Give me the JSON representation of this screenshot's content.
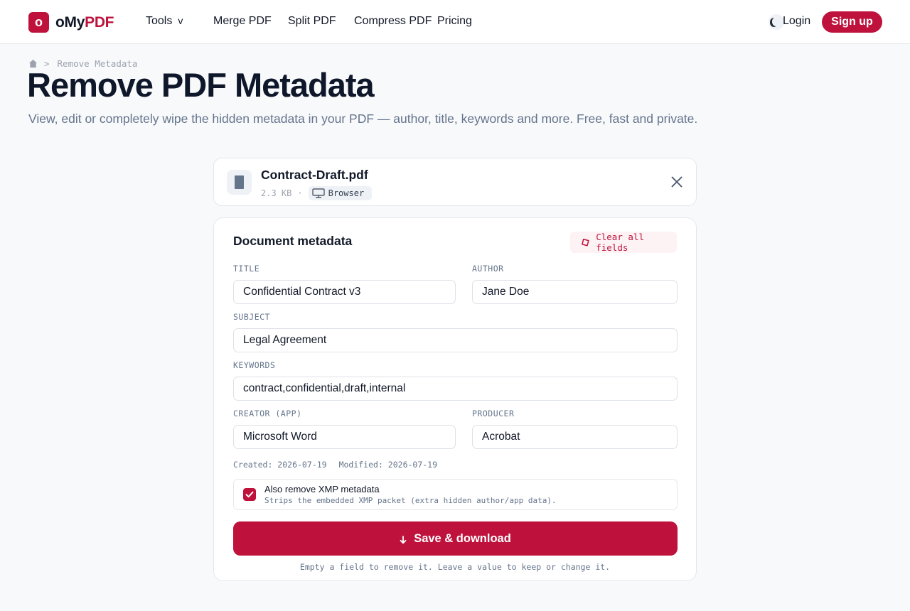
{
  "brand": {
    "mark": "o",
    "name_part1": "oMy",
    "name_part2": "PDF",
    "accent": "#be123c"
  },
  "nav": {
    "tools": "Tools",
    "tools_chevron": "v",
    "merge": "Merge PDF",
    "split": "Split PDF",
    "compress": "Compress PDF",
    "pricing": "Pricing",
    "theme_icon": "moon-icon",
    "login": "Login",
    "signup": "Sign up"
  },
  "breadcrumb": {
    "home_icon": "home-icon",
    "separator": ">",
    "current": "Remove Metadata"
  },
  "hero": {
    "title": "Remove PDF Metadata",
    "lead": "View, edit or completely wipe the hidden metadata in your PDF — author, title, keywords and more. Free, fast and private."
  },
  "file": {
    "name": "Contract-Draft.pdf",
    "size": "2.3 KB",
    "dot": "·",
    "location": "Browser",
    "icon": "file-icon",
    "close_icon": "close-icon"
  },
  "form": {
    "title": "Document metadata",
    "clear_label": "Clear all fields",
    "clear_icon": "eraser-icon",
    "fields": {
      "title": {
        "label": "TITLE",
        "value": "Confidential Contract v3"
      },
      "author": {
        "label": "AUTHOR",
        "value": "Jane Doe"
      },
      "subject": {
        "label": "SUBJECT",
        "value": "Legal Agreement"
      },
      "keywords": {
        "label": "KEYWORDS",
        "value": "contract,confidential,draft,internal"
      },
      "creator": {
        "label": "CREATOR (APP)",
        "value": "Microsoft Word"
      },
      "producer": {
        "label": "PRODUCER",
        "value": "Acrobat"
      }
    },
    "created": "Created: 2026-07-19",
    "modified": "Modified: 2026-07-19",
    "xmp": {
      "checked": true,
      "title": "Also remove XMP metadata",
      "subtitle": "Strips the embedded XMP packet (extra hidden author/app data)."
    },
    "save_label": "Save & download",
    "save_icon": "arrow-down-icon",
    "hint": "Empty a field to remove it. Leave a value to keep or change it."
  }
}
